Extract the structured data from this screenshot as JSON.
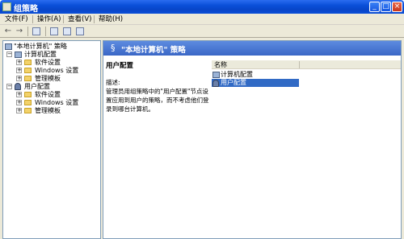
{
  "window": {
    "title": "组策略",
    "min_label": "_",
    "max_label": "□",
    "close_label": "×"
  },
  "menu": [
    "文件(F)",
    "操作(A)",
    "查看(V)",
    "帮助(H)"
  ],
  "toolbar": {
    "back": "←",
    "forward": "→"
  },
  "tree": {
    "root": "\"本地计算机\" 策略",
    "computer": "计算机配置",
    "user": "用户配置",
    "children": [
      "软件设置",
      "Windows 设置",
      "管理模板"
    ]
  },
  "right": {
    "header": "\"本地计算机\" 策略",
    "section_title": "用户配置",
    "desc_label": "描述:",
    "desc_text": "管理员用组策略中的\"用户配置\"节点设置应用到用户的策略，而不考虑他们登录到哪台计算机。",
    "column_name": "名称",
    "rows": [
      "计算机配置",
      "用户配置"
    ]
  },
  "colors": {
    "titlebar": "#0a4fd8",
    "selection": "#316ac5",
    "chrome": "#ece9d8"
  }
}
